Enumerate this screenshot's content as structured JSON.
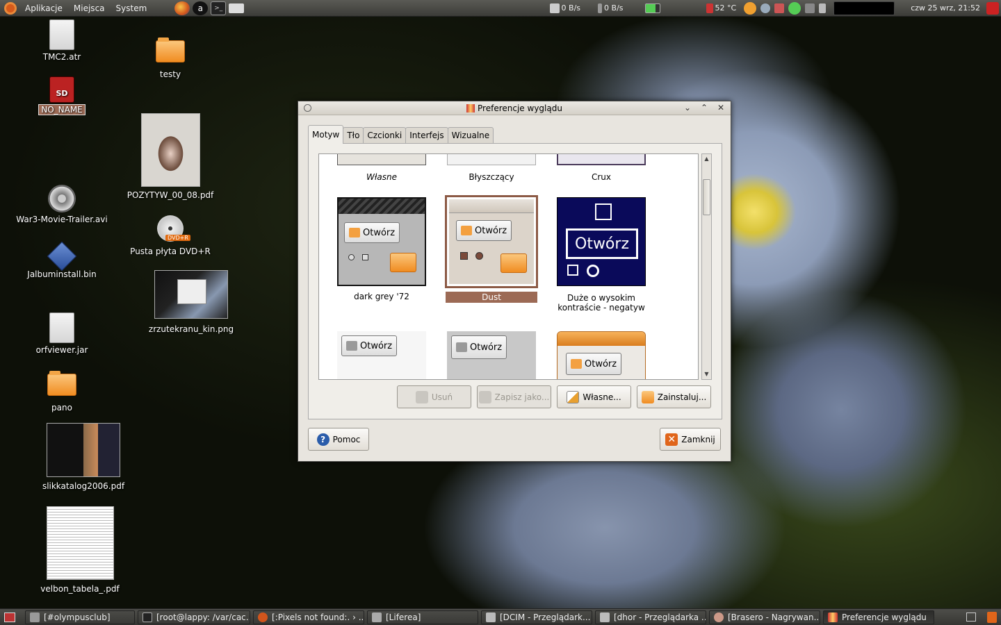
{
  "top_panel": {
    "menus": [
      "Aplikacje",
      "Miejsca",
      "System"
    ],
    "net_down": "0 B/s",
    "net_up": "0 B/s",
    "temperature": "52 °C",
    "clock": "czw 25 wrz, 21:52"
  },
  "desktop": {
    "icons": [
      {
        "label": "TMC2.atr",
        "kind": "document"
      },
      {
        "label": "NO_NAME",
        "kind": "sd-card"
      },
      {
        "label": "War3-Movie-Trailer.avi",
        "kind": "video"
      },
      {
        "label": "Jalbuminstall.bin",
        "kind": "binary"
      },
      {
        "label": "orfviewer.jar",
        "kind": "document"
      },
      {
        "label": "pano",
        "kind": "folder"
      },
      {
        "label": "slikkatalog2006.pdf",
        "kind": "pdf-thumb"
      },
      {
        "label": "velbon_tabela_.pdf",
        "kind": "pdf-thumb"
      },
      {
        "label": "testy",
        "kind": "folder"
      },
      {
        "label": "POZYTYW_00_08.pdf",
        "kind": "pdf-thumb"
      },
      {
        "label": "Pusta płyta DVD+R",
        "kind": "dvd"
      },
      {
        "label": "zrzutekranu_kin.png",
        "kind": "image-thumb"
      }
    ],
    "sd_badge": "SD",
    "dvd_badge": "DVD+R"
  },
  "dialog": {
    "title": "Preferencje wyglądu",
    "tabs": [
      "Motyw",
      "Tło",
      "Czcionki",
      "Interfejs",
      "Wizualne"
    ],
    "active_tab": "Motyw",
    "themes": [
      {
        "label": "Własne"
      },
      {
        "label": "Błyszczący"
      },
      {
        "label": "Crux"
      },
      {
        "label": "dark grey  '72"
      },
      {
        "label": "Dust"
      },
      {
        "label": "Duże o wysokim kontraście - negatyw"
      }
    ],
    "selected_theme": "Dust",
    "preview_button_label": "Otwórz",
    "buttons": {
      "delete": "Usuń",
      "save_as": "Zapisz jako...",
      "custom": "Własne...",
      "install": "Zainstaluj...",
      "help": "Pomoc",
      "close": "Zamknij"
    }
  },
  "taskbar": {
    "tasks": [
      {
        "label": "[#olympusclub]"
      },
      {
        "label": "[root@lappy: /var/cac..."
      },
      {
        "label": "[:Pixels not found:. › ..."
      },
      {
        "label": "[Liferea]"
      },
      {
        "label": "[DCIM - Przeglądark..."
      },
      {
        "label": "[dhor - Przeglądarka ..."
      },
      {
        "label": "[Brasero - Nagrywan..."
      },
      {
        "label": "Preferencje wyglądu"
      }
    ]
  },
  "colors": {
    "selection": "#9c6a55",
    "panel": "#3c3c38",
    "dialog_bg": "#e8e5df"
  }
}
